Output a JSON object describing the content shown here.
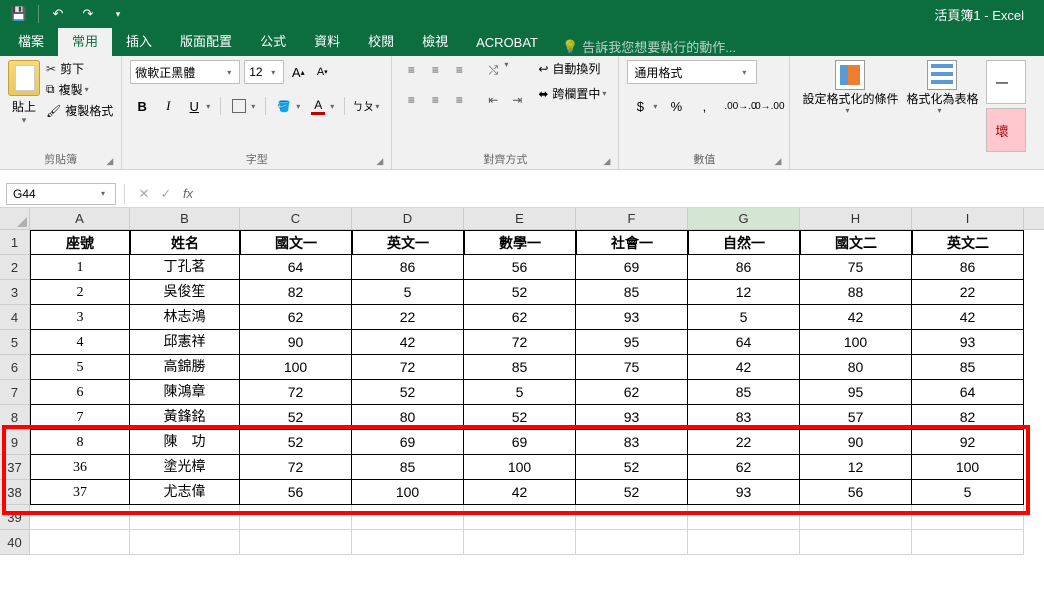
{
  "title": "活頁簿1 - Excel",
  "tabs": {
    "file": "檔案",
    "home": "常用",
    "insert": "插入",
    "layout": "版面配置",
    "formulas": "公式",
    "data": "資料",
    "review": "校閱",
    "view": "檢視",
    "acrobat": "ACROBAT"
  },
  "tellme": "告訴我您想要執行的動作...",
  "ribbon": {
    "paste": "貼上",
    "cut": "剪下",
    "copy": "複製",
    "fmtpaint": "複製格式",
    "clipboard": "剪貼簿",
    "fontname": "微軟正黑體",
    "fontsize": "12",
    "font": "字型",
    "align": "對齊方式",
    "wrap": "自動換列",
    "merge": "跨欄置中",
    "numformat": "通用格式",
    "number": "數值",
    "condfmt": "設定格式化的條件",
    "tblfmt": "格式化為表格",
    "bad": "壞"
  },
  "namebox": "G44",
  "colheaders": [
    "A",
    "B",
    "C",
    "D",
    "E",
    "F",
    "G",
    "H",
    "I"
  ],
  "hdr": {
    "A": "座號",
    "B": "姓名",
    "C": "國文一",
    "D": "英文一",
    "E": "數學一",
    "F": "社會一",
    "G": "自然一",
    "H": "國文二",
    "I": "英文二"
  },
  "rows": [
    {
      "rn": "1"
    },
    {
      "rn": "2",
      "A": "1",
      "B": "丁孔茗",
      "C": "64",
      "D": "86",
      "E": "56",
      "F": "69",
      "G": "86",
      "H": "75",
      "I": "86"
    },
    {
      "rn": "3",
      "A": "2",
      "B": "吳俊笙",
      "C": "82",
      "D": "5",
      "E": "52",
      "F": "85",
      "G": "12",
      "H": "88",
      "I": "22"
    },
    {
      "rn": "4",
      "A": "3",
      "B": "林志鴻",
      "C": "62",
      "D": "22",
      "E": "62",
      "F": "93",
      "G": "5",
      "H": "42",
      "I": "42"
    },
    {
      "rn": "5",
      "A": "4",
      "B": "邱憲祥",
      "C": "90",
      "D": "42",
      "E": "72",
      "F": "95",
      "G": "64",
      "H": "100",
      "I": "93"
    },
    {
      "rn": "6",
      "A": "5",
      "B": "高錦勝",
      "C": "100",
      "D": "72",
      "E": "85",
      "F": "75",
      "G": "42",
      "H": "80",
      "I": "85"
    },
    {
      "rn": "7",
      "A": "6",
      "B": "陳鴻章",
      "C": "72",
      "D": "52",
      "E": "5",
      "F": "62",
      "G": "85",
      "H": "95",
      "I": "64"
    },
    {
      "rn": "8",
      "A": "7",
      "B": "黃鋒銘",
      "C": "52",
      "D": "80",
      "E": "52",
      "F": "93",
      "G": "83",
      "H": "57",
      "I": "82"
    },
    {
      "rn": "9",
      "A": "8",
      "B": "陳　功",
      "C": "52",
      "D": "69",
      "E": "69",
      "F": "83",
      "G": "22",
      "H": "90",
      "I": "92"
    },
    {
      "rn": "37",
      "A": "36",
      "B": "塗光樟",
      "C": "72",
      "D": "85",
      "E": "100",
      "F": "52",
      "G": "62",
      "H": "12",
      "I": "100"
    },
    {
      "rn": "38",
      "A": "37",
      "B": "尤志偉",
      "C": "56",
      "D": "100",
      "E": "42",
      "F": "52",
      "G": "93",
      "H": "56",
      "I": "5"
    },
    {
      "rn": "39"
    },
    {
      "rn": "40"
    }
  ],
  "chart_data": {
    "type": "table",
    "title": "",
    "columns": [
      "座號",
      "姓名",
      "國文一",
      "英文一",
      "數學一",
      "社會一",
      "自然一",
      "國文二",
      "英文二"
    ],
    "rows": [
      [
        1,
        "丁孔茗",
        64,
        86,
        56,
        69,
        86,
        75,
        86
      ],
      [
        2,
        "吳俊笙",
        82,
        5,
        52,
        85,
        12,
        88,
        22
      ],
      [
        3,
        "林志鴻",
        62,
        22,
        62,
        93,
        5,
        42,
        42
      ],
      [
        4,
        "邱憲祥",
        90,
        42,
        72,
        95,
        64,
        100,
        93
      ],
      [
        5,
        "高錦勝",
        100,
        72,
        85,
        75,
        42,
        80,
        85
      ],
      [
        6,
        "陳鴻章",
        72,
        52,
        5,
        62,
        85,
        95,
        64
      ],
      [
        7,
        "黃鋒銘",
        52,
        80,
        52,
        93,
        83,
        57,
        82
      ],
      [
        8,
        "陳　功",
        52,
        69,
        69,
        83,
        22,
        90,
        92
      ],
      [
        36,
        "塗光樟",
        72,
        85,
        100,
        52,
        62,
        12,
        100
      ],
      [
        37,
        "尤志偉",
        56,
        100,
        42,
        52,
        93,
        56,
        5
      ]
    ]
  }
}
